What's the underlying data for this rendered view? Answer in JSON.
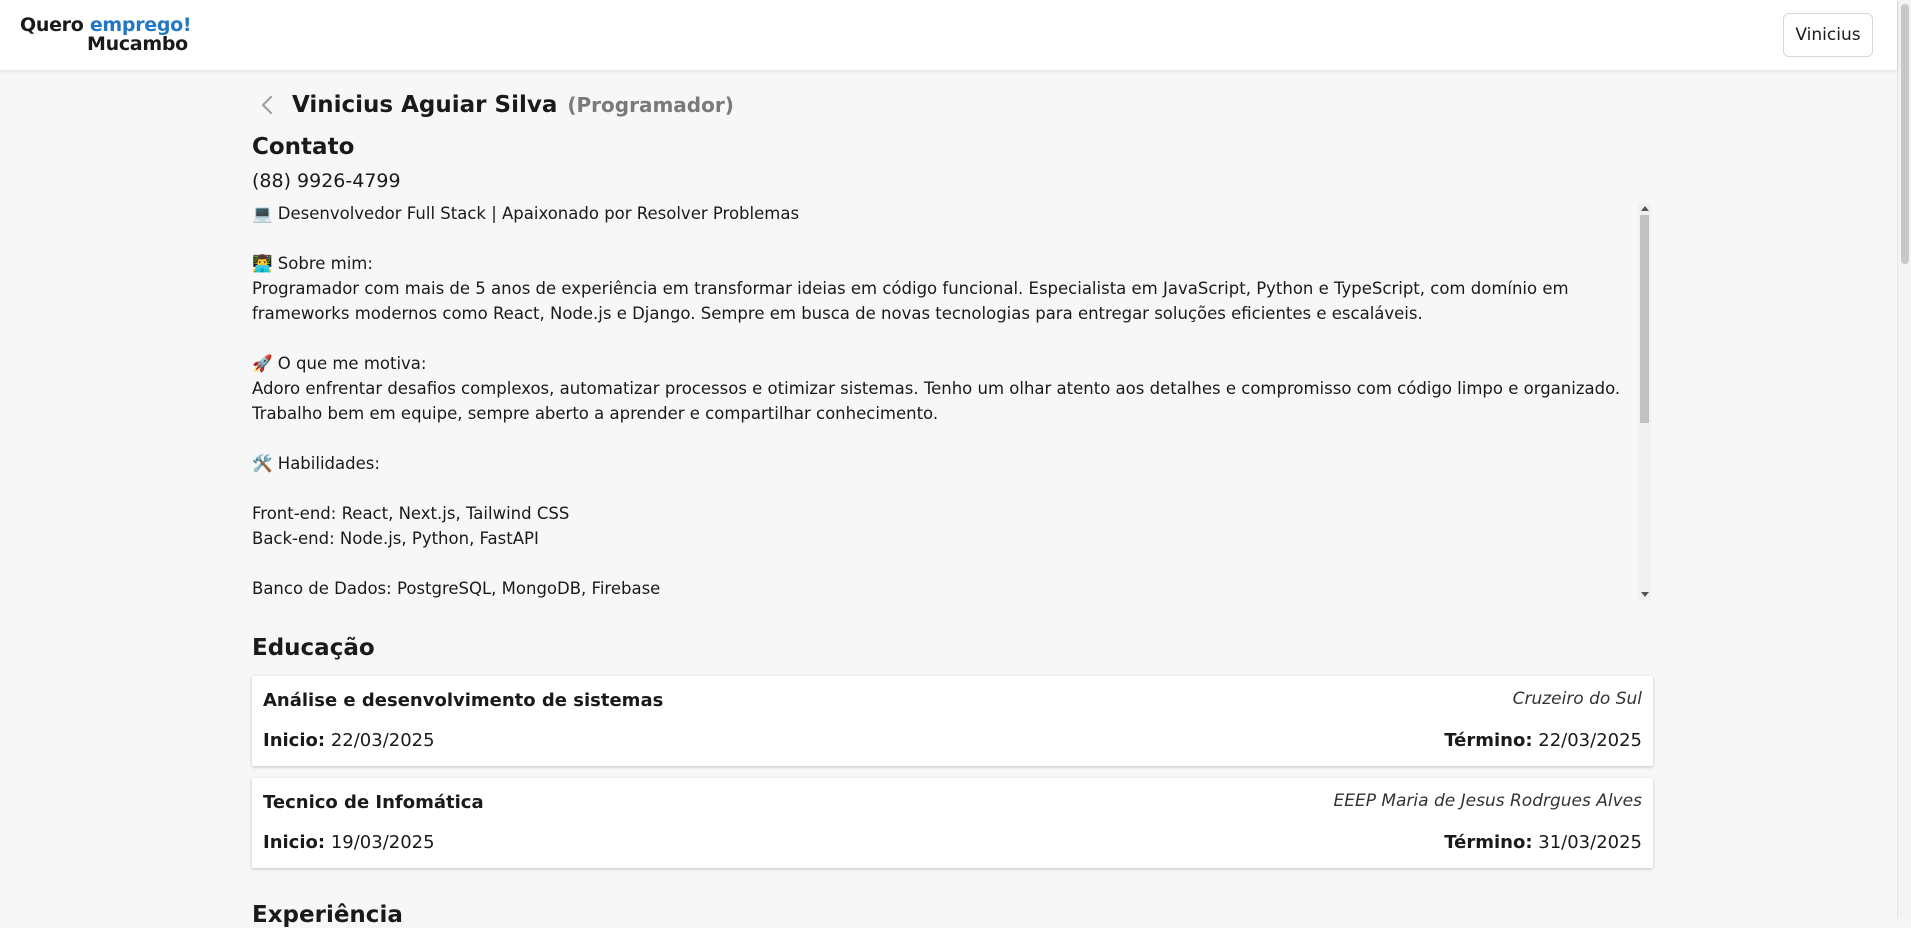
{
  "header": {
    "logo_line1_prefix": "Quero ",
    "logo_line1_accent": "emprego!",
    "logo_line2": "Mucambo",
    "user_button": "Vinicius",
    "accent_color": "#2378c6"
  },
  "profile": {
    "name": "Vinicius Aguiar Silva",
    "role": "(Programador)"
  },
  "contact": {
    "heading": "Contato",
    "phone": "(88) 9926-4799",
    "bio": "💻 Desenvolvedor Full Stack | Apaixonado por Resolver Problemas\n\n👨‍💻 Sobre mim:\nProgramador com mais de 5 anos de experiência em transformar ideias em código funcional. Especialista em JavaScript, Python e TypeScript, com domínio em frameworks modernos como React, Node.js e Django. Sempre em busca de novas tecnologias para entregar soluções eficientes e escaláveis.\n\n🚀 O que me motiva:\nAdoro enfrentar desafios complexos, automatizar processos e otimizar sistemas. Tenho um olhar atento aos detalhes e compromisso com código limpo e organizado. Trabalho bem em equipe, sempre aberto a aprender e compartilhar conhecimento.\n\n🛠️ Habilidades:\n\nFront-end: React, Next.js, Tailwind CSS\nBack-end: Node.js, Python, FastAPI\n\nBanco de Dados: PostgreSQL, MongoDB, Firebase"
  },
  "education": {
    "heading": "Educação",
    "start_label": "Inicio:",
    "end_label": "Término:",
    "items": [
      {
        "course": "Análise e desenvolvimento de sistemas",
        "institution": "Cruzeiro do Sul",
        "start": "22/03/2025",
        "end": "22/03/2025"
      },
      {
        "course": "Tecnico de Infomática",
        "institution": "EEEP Maria de Jesus Rodrgues Alves",
        "start": "19/03/2025",
        "end": "31/03/2025"
      }
    ]
  },
  "experience": {
    "heading": "Experiência"
  }
}
